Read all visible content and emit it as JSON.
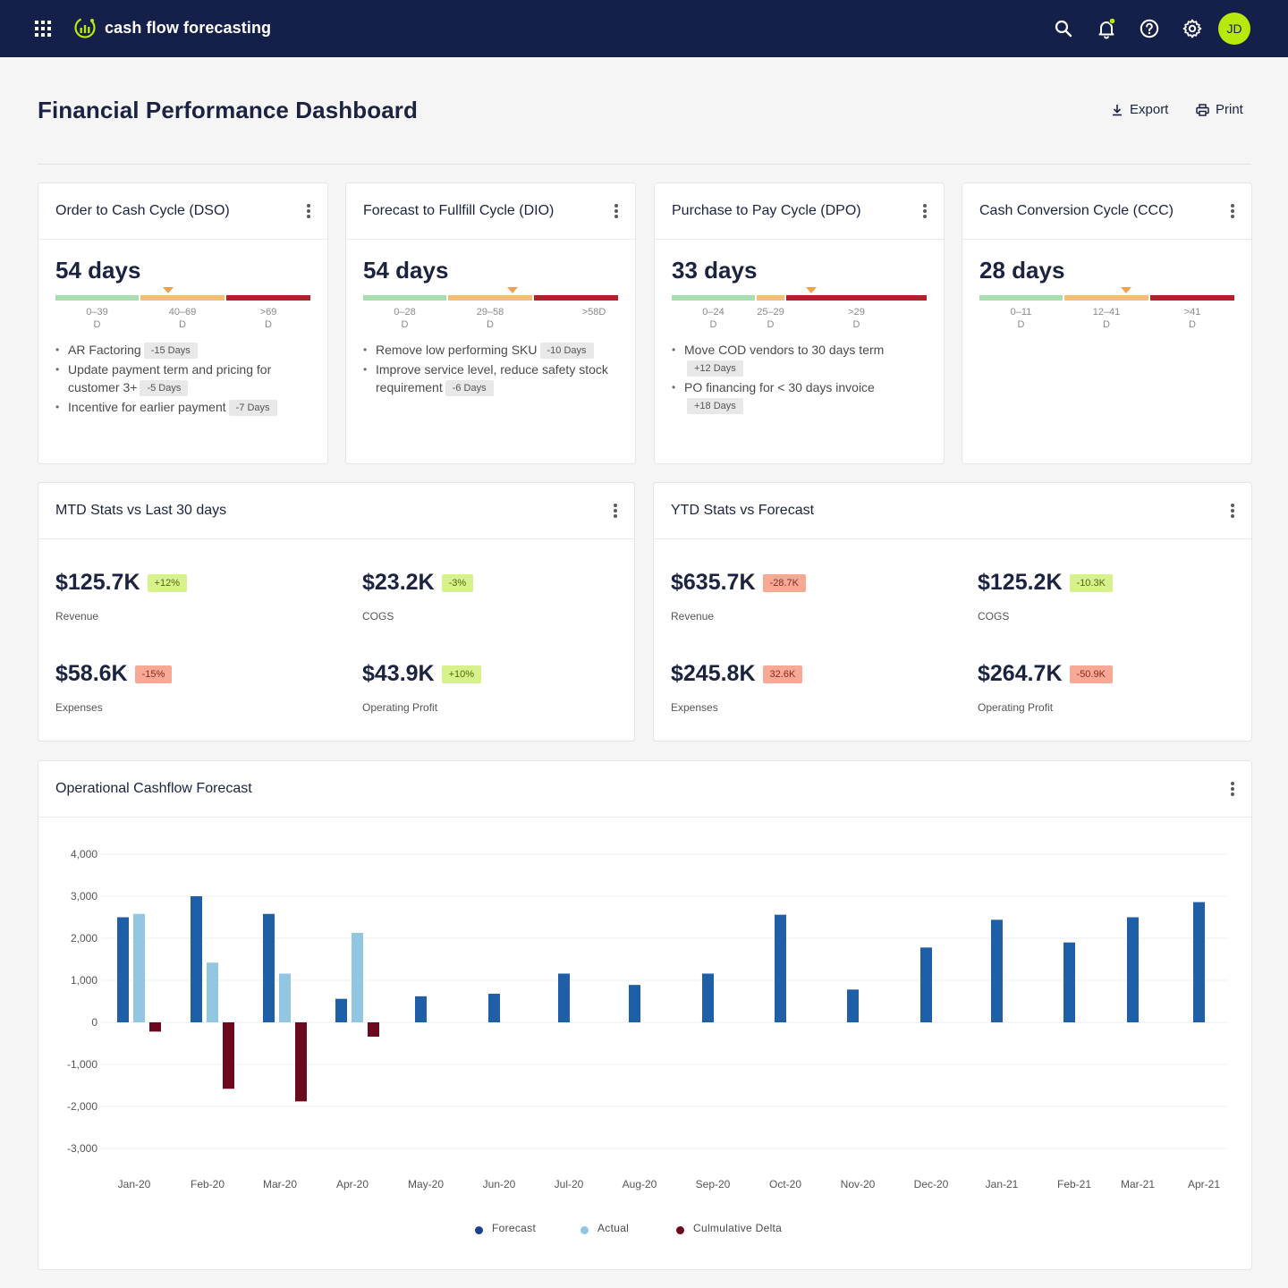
{
  "app": {
    "name": "cash flow forecasting",
    "user_initials": "JD",
    "icons": [
      "apps-grid-icon",
      "chart-logo-icon",
      "search-icon",
      "bell-icon",
      "help-icon",
      "gear-icon"
    ],
    "accent": "#b8e90d",
    "navbar_color": "#14204a"
  },
  "page": {
    "title": "Financial Performance Dashboard",
    "export_label": "Export",
    "print_label": "Print"
  },
  "cycles": [
    {
      "title": "Order to Cash Cycle (DSO)",
      "value": "54 days",
      "ranges": [
        [
          "0–39",
          "D"
        ],
        [
          "40–69",
          "D"
        ],
        [
          ">69",
          "D"
        ]
      ],
      "marker_segment": 2,
      "recs": [
        {
          "text": "AR Factoring",
          "chip": "-15 Days"
        },
        {
          "text": "Update payment term and pricing for customer 3+",
          "chip": "-5 Days"
        },
        {
          "text": "Incentive for earlier payment",
          "chip": "-7 Days"
        }
      ]
    },
    {
      "title": "Forecast to Fullfill Cycle (DIO)",
      "value": "54 days",
      "ranges": [
        [
          "0–28",
          "D"
        ],
        [
          "29–58",
          "D"
        ],
        [
          ">58D",
          ""
        ]
      ],
      "marker_segment": 2,
      "recs": [
        {
          "text": "Remove low performing SKU",
          "chip": "-10 Days"
        },
        {
          "text": "Improve service level, reduce safety stock requirement",
          "chip": "-6 Days"
        }
      ]
    },
    {
      "title": "Purchase to Pay Cycle (DPO)",
      "value": "33 days",
      "ranges": [
        [
          "0–24",
          "D"
        ],
        [
          "25–29",
          "D"
        ],
        [
          ">29",
          "D"
        ]
      ],
      "marker_segment": 3,
      "recs": [
        {
          "text": "Move COD vendors to 30 days term",
          "chip": "+12 Days"
        },
        {
          "text": "PO financing for < 30 days invoice",
          "chip": "+18 Days"
        }
      ]
    },
    {
      "title": "Cash Conversion Cycle (CCC)",
      "value": "28 days",
      "ranges": [
        [
          "0–11",
          "D"
        ],
        [
          "12–41",
          "D"
        ],
        [
          ">41",
          "D"
        ]
      ],
      "marker_segment": 2,
      "recs": []
    }
  ],
  "mtd": {
    "title": "MTD Stats vs Last 30 days",
    "stats": [
      {
        "value": "$125.7K",
        "badge": "+12%",
        "tone": "green",
        "label": "Revenue"
      },
      {
        "value": "$23.2K",
        "badge": "-3%",
        "tone": "green",
        "label": "COGS"
      },
      {
        "value": "$58.6K",
        "badge": "-15%",
        "tone": "red",
        "label": "Expenses"
      },
      {
        "value": "$43.9K",
        "badge": "+10%",
        "tone": "green",
        "label": "Operating Profit"
      }
    ]
  },
  "ytd": {
    "title": "YTD Stats vs Forecast",
    "stats": [
      {
        "value": "$635.7K",
        "badge": "-28.7K",
        "tone": "red",
        "label": "Revenue"
      },
      {
        "value": "$125.2K",
        "badge": "-10.3K",
        "tone": "green",
        "label": "COGS"
      },
      {
        "value": "$245.8K",
        "badge": "32.6K",
        "tone": "red",
        "label": "Expenses"
      },
      {
        "value": "$264.7K",
        "badge": "-50.9K",
        "tone": "red",
        "label": "Operating Profit"
      }
    ]
  },
  "chart_data": {
    "title": "Operational Cashflow Forecast",
    "type": "bar",
    "categories": [
      "Jan-20",
      "Feb-20",
      "Mar-20",
      "Apr-20",
      "May-20",
      "Jun-20",
      "Jul-20",
      "Aug-20",
      "Sep-20",
      "Oct-20",
      "Nov-20",
      "Dec-20",
      "Jan-21",
      "Feb-21",
      "Mar-21",
      "Apr-21"
    ],
    "ylim": [
      -3000,
      4000
    ],
    "yticks": [
      "4,000",
      "3,000",
      "2,000",
      "1,000",
      "0",
      "-1,000",
      "-2,000",
      "-3,000"
    ],
    "grid": true,
    "legend_position": "bottom-center",
    "series": [
      {
        "name": "Forecast",
        "color": "#1f5fa8",
        "values": [
          2500,
          3000,
          2580,
          560,
          620,
          680,
          1160,
          890,
          1160,
          2560,
          780,
          1780,
          2440,
          1900,
          2500,
          2860
        ]
      },
      {
        "name": "Actual",
        "color": "#93c6e0",
        "values": [
          2580,
          1420,
          1160,
          2130,
          null,
          null,
          null,
          null,
          null,
          null,
          null,
          null,
          null,
          null,
          null,
          null
        ]
      },
      {
        "name": "Culmulative Delta",
        "color": "#6b0a1e",
        "values": [
          -220,
          -1580,
          -1880,
          -340,
          null,
          null,
          null,
          null,
          null,
          null,
          null,
          null,
          null,
          null,
          null,
          null
        ]
      }
    ]
  }
}
